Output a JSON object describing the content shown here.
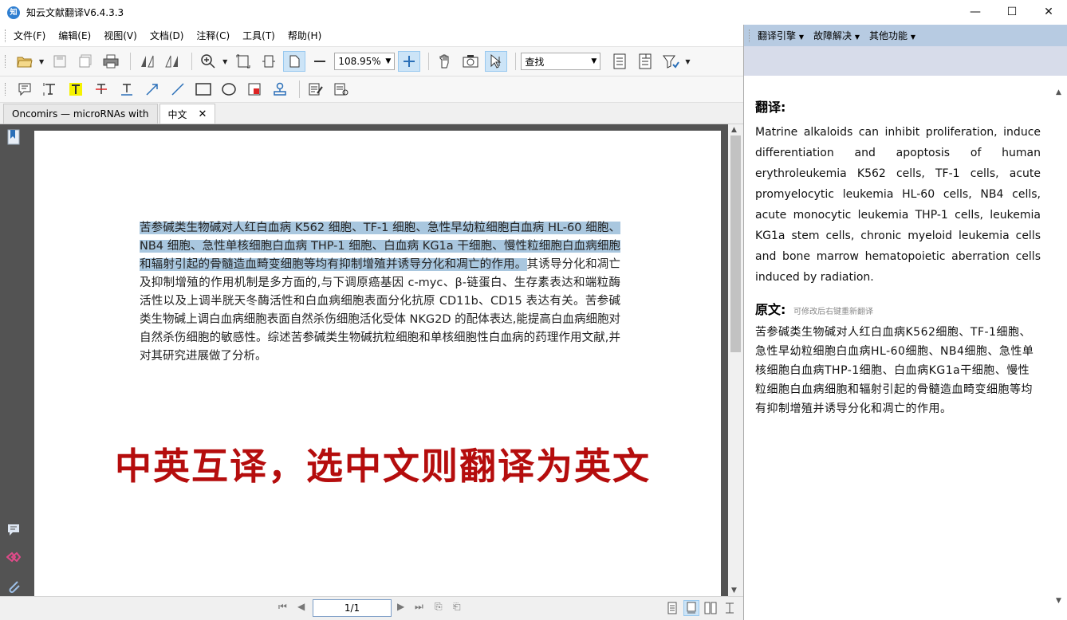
{
  "titlebar": {
    "icon_text": "知",
    "title": "知云文献翻译V6.4.3.3",
    "minimize": "—",
    "maximize": "☐",
    "close": "✕"
  },
  "menu": {
    "items": [
      "文件(F)",
      "编辑(E)",
      "视图(V)",
      "文档(D)",
      "注释(C)",
      "工具(T)",
      "帮助(H)"
    ]
  },
  "toolbar": {
    "zoom_value": "108.95%",
    "find_value": "查找"
  },
  "tabs": [
    {
      "label": "Oncomirs — microRNAs with"
    },
    {
      "label": "中文",
      "close": "✕"
    }
  ],
  "document": {
    "highlighted_text": "苦参碱类生物碱对人红白血病 K562 细胞、TF-1 细胞、急性早幼粒细胞白血病 HL-60 细胞、NB4 细胞、急性单核细胞白血病 THP-1 细胞、白血病 KG1a 干细胞、慢性粒细胞白血病细胞和辐射引起的骨髓造血畸变细胞等均有抑制增殖并诱导分化和凋亡的作用。",
    "rest_text": "其诱导分化和凋亡及抑制增殖的作用机制是多方面的,与下调原癌基因 c-myc、β-链蛋白、生存素表达和端粒酶活性以及上调半胱天冬酶活性和白血病细胞表面分化抗原 CD11b、CD15 表达有关。苦参碱类生物碱上调白血病细胞表面自然杀伤细胞活化受体 NKG2D 的配体表达,能提高白血病细胞对自然杀伤细胞的敏感性。综述苦参碱类生物碱抗粒细胞和单核细胞性白血病的药理作用文献,并对其研究进展做了分析。",
    "overlay": "中英互译，选中文则翻译为英文"
  },
  "pagination": {
    "page": "1/1"
  },
  "right_pane": {
    "menus": [
      "翻译引擎",
      "故障解决",
      "其他功能"
    ],
    "translation_heading": "翻译:",
    "translation": "Matrine alkaloids can inhibit proliferation, induce differentiation and apoptosis of human erythroleukemia K562 cells, TF-1 cells, acute promyelocytic leukemia HL-60 cells, NB4 cells, acute monocytic leukemia THP-1 cells, leukemia KG1a stem cells, chronic myeloid leukemia cells and bone marrow hematopoietic aberration cells induced by radiation.",
    "original_heading": "原文:",
    "original_note": "可修改后右键重新翻译",
    "original": "苦参碱类生物碱对人红白血病K562细胞、TF-1细胞、急性早幼粒细胞白血病HL-60细胞、NB4细胞、急性单核细胞白血病THP-1细胞、白血病KG1a干细胞、慢性粒细胞白血病细胞和辐射引起的骨髓造血畸变细胞等均有抑制增殖并诱导分化和凋亡的作用。"
  }
}
